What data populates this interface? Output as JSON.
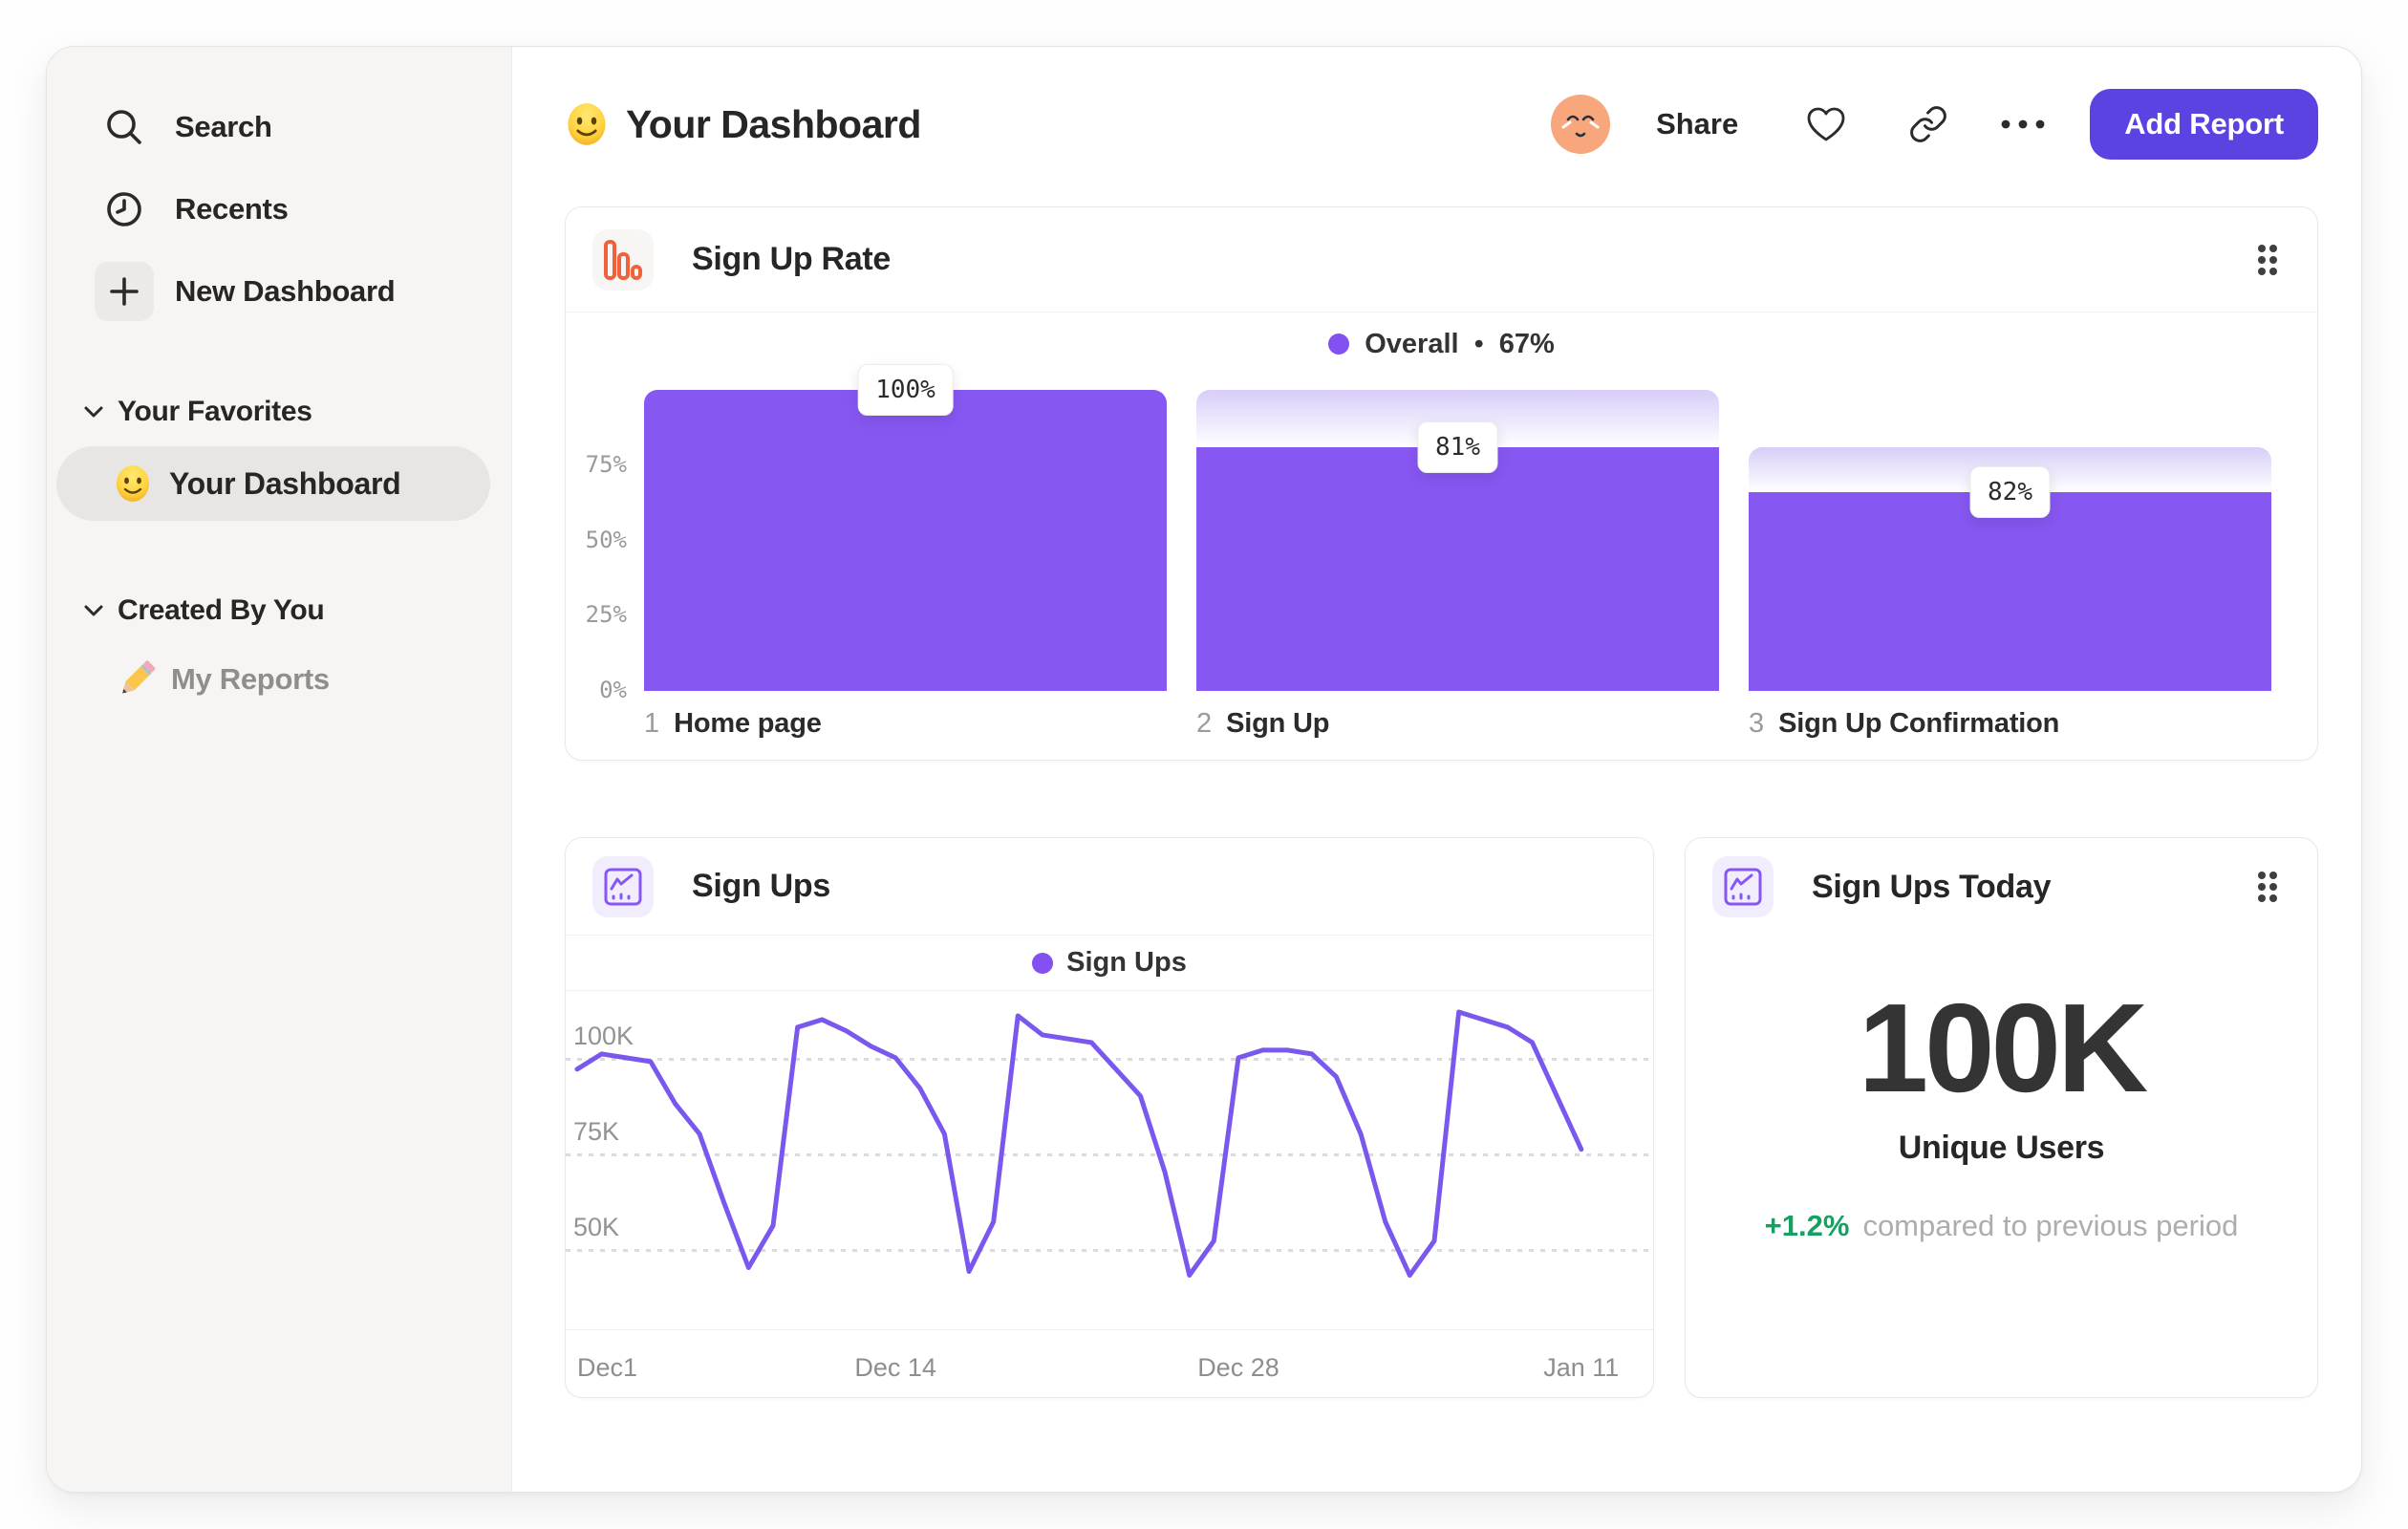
{
  "sidebar": {
    "items": [
      {
        "id": "search",
        "label": "Search"
      },
      {
        "id": "recents",
        "label": "Recents"
      },
      {
        "id": "new-dashboard",
        "label": "New Dashboard"
      }
    ],
    "sections": [
      {
        "title": "Your Favorites"
      },
      {
        "title": "Created By You"
      }
    ],
    "favorites_item": {
      "label": "Your Dashboard"
    },
    "created_item": {
      "label": "My Reports"
    }
  },
  "header": {
    "title": "Your Dashboard",
    "share_label": "Share",
    "add_report_label": "Add Report"
  },
  "cards": {
    "funnel": {
      "title": "Sign Up Rate",
      "legend_label": "Overall",
      "legend_sep": "•",
      "legend_value": "67%"
    },
    "line": {
      "title": "Sign Ups",
      "legend_label": "Sign Ups"
    },
    "kpi": {
      "title": "Sign Ups Today",
      "value": "100K",
      "sublabel": "Unique Users",
      "delta": "+1.2%",
      "delta_note": "compared to previous period"
    }
  },
  "colors": {
    "bar_purple": "#8757F2",
    "cap_top": "#D8CDF8",
    "line_purple": "#7A58EE",
    "legend_dot": "#8350F2",
    "button_indigo": "#5A43E1",
    "green": "#16A163",
    "icon_orange": "#F0613C",
    "icon_purple": "#8757F5"
  },
  "chart_data": [
    {
      "type": "bar",
      "subtype": "funnel",
      "title": "Sign Up Rate",
      "legend": {
        "label": "Overall",
        "value_pct": 67
      },
      "categories": [
        "Home page",
        "Sign Up",
        "Sign Up Confirmation"
      ],
      "step_numbers": [
        "1",
        "2",
        "3"
      ],
      "series": [
        {
          "name": "overall-conversion-pct",
          "values": [
            100,
            81,
            66
          ]
        },
        {
          "name": "step-conversion-pct",
          "values": [
            100,
            81,
            82
          ]
        }
      ],
      "tooltip_labels": [
        "100%",
        "81%",
        "82%"
      ],
      "cap_top_pct": [
        null,
        100,
        81
      ],
      "y_ticks": [
        {
          "label": "75%",
          "pct": 75
        },
        {
          "label": "50%",
          "pct": 50
        },
        {
          "label": "25%",
          "pct": 25
        },
        {
          "label": "0%",
          "pct": 0
        }
      ],
      "ylim": [
        0,
        100
      ],
      "grid": false,
      "legend_position": "top-center"
    },
    {
      "type": "line",
      "title": "Sign Ups",
      "legend": [
        "Sign Ups"
      ],
      "x_ticks": [
        "Dec1",
        "Dec 14",
        "Dec 28",
        "Jan 11"
      ],
      "x_tick_indices": [
        0,
        13,
        27,
        41
      ],
      "axis_slots": 44,
      "y_ticks": [
        {
          "label": "100K",
          "value": 100
        },
        {
          "label": "75K",
          "value": 75
        },
        {
          "label": "50K",
          "value": 50
        }
      ],
      "unit": "thousands-of-sign-ups-per-day",
      "values": [
        97,
        101,
        100,
        99,
        88,
        80,
        62,
        45,
        56,
        108,
        110,
        107,
        103,
        100,
        92,
        80,
        44,
        57,
        111,
        106,
        105,
        104,
        97,
        90,
        70,
        43,
        52,
        100,
        102,
        102,
        101,
        95,
        80,
        57,
        43,
        52,
        112,
        110,
        108,
        104,
        90,
        76
      ],
      "ylim": [
        30,
        115
      ],
      "grid": "dotted-horizontal",
      "legend_position": "top-center"
    }
  ]
}
